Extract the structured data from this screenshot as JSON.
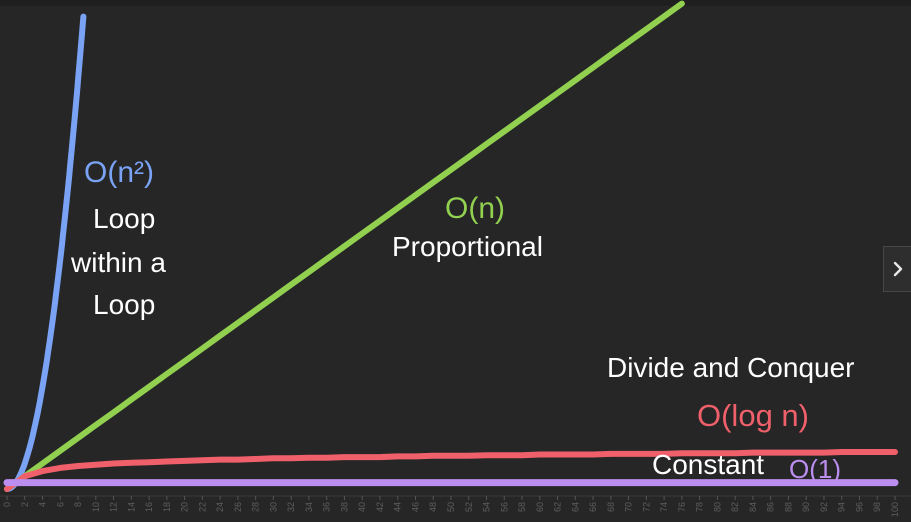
{
  "chart_data": {
    "type": "line",
    "x": [
      0,
      2,
      4,
      6,
      8,
      10,
      12,
      14,
      16,
      18,
      20,
      22,
      24,
      26,
      28,
      30,
      32,
      34,
      36,
      38,
      40,
      42,
      44,
      46,
      48,
      50,
      52,
      54,
      56,
      58,
      60,
      62,
      64,
      66,
      68,
      70,
      72,
      74,
      76,
      78,
      80,
      82,
      84,
      86,
      88,
      90,
      92,
      94,
      96,
      98,
      100
    ],
    "xlim": [
      0,
      100
    ],
    "ylim": [
      0,
      75
    ],
    "grid": false,
    "legend": "none",
    "series": [
      {
        "name": "O(n²)",
        "color": "#7aa3f5",
        "values": [
          0,
          4,
          16,
          36,
          64,
          100
        ]
      },
      {
        "name": "O(n)",
        "color": "#92d050",
        "values": [
          0,
          2,
          4,
          6,
          8,
          10,
          12,
          14,
          16,
          18,
          20,
          22,
          24,
          26,
          28,
          30,
          32,
          34,
          36,
          38,
          40,
          42,
          44,
          46,
          48,
          50,
          52,
          54,
          56,
          58,
          60,
          62,
          64,
          66,
          68,
          70,
          72,
          74,
          76
        ]
      },
      {
        "name": "O(log n)",
        "color": "#f0606b",
        "values": [
          0,
          2.0,
          2.8,
          3.3,
          3.6,
          3.8,
          4.0,
          4.1,
          4.2,
          4.3,
          4.4,
          4.5,
          4.6,
          4.6,
          4.7,
          4.8,
          4.8,
          4.9,
          4.9,
          5.0,
          5.0,
          5.0,
          5.1,
          5.1,
          5.2,
          5.2,
          5.2,
          5.3,
          5.3,
          5.3,
          5.4,
          5.4,
          5.4,
          5.4,
          5.5,
          5.5,
          5.5,
          5.5,
          5.6,
          5.6,
          5.6,
          5.6,
          5.7,
          5.7,
          5.7,
          5.7,
          5.7,
          5.8,
          5.8,
          5.8,
          5.8
        ]
      },
      {
        "name": "O(1)",
        "color": "#bb8ef0",
        "values": [
          1,
          1,
          1,
          1,
          1,
          1,
          1,
          1,
          1,
          1,
          1,
          1,
          1,
          1,
          1,
          1,
          1,
          1,
          1,
          1,
          1,
          1,
          1,
          1,
          1,
          1,
          1,
          1,
          1,
          1,
          1,
          1,
          1,
          1,
          1,
          1,
          1,
          1,
          1,
          1,
          1,
          1,
          1,
          1,
          1,
          1,
          1,
          1,
          1,
          1,
          1
        ]
      }
    ],
    "tick_labels": [
      "0",
      "2",
      "4",
      "6",
      "8",
      "10",
      "12",
      "14",
      "16",
      "18",
      "20",
      "22",
      "24",
      "26",
      "28",
      "30",
      "32",
      "34",
      "36",
      "38",
      "40",
      "42",
      "44",
      "46",
      "48",
      "50",
      "52",
      "54",
      "56",
      "58",
      "60",
      "62",
      "64",
      "66",
      "68",
      "70",
      "72",
      "74",
      "76",
      "78",
      "80",
      "82",
      "84",
      "86",
      "88",
      "90",
      "92",
      "94",
      "96",
      "98",
      "100"
    ],
    "annotations": {
      "n2": {
        "label": "O(n²)",
        "line1": "Loop",
        "line2": "within a",
        "line3": "Loop"
      },
      "n": {
        "label": "O(n)",
        "desc": "Proportional"
      },
      "logn": {
        "desc": "Divide and Conquer",
        "label": "O(log n)"
      },
      "const": {
        "desc": "Constant",
        "label": "O(1)"
      }
    }
  },
  "nav": {
    "next_icon": "chevron-right-icon"
  }
}
